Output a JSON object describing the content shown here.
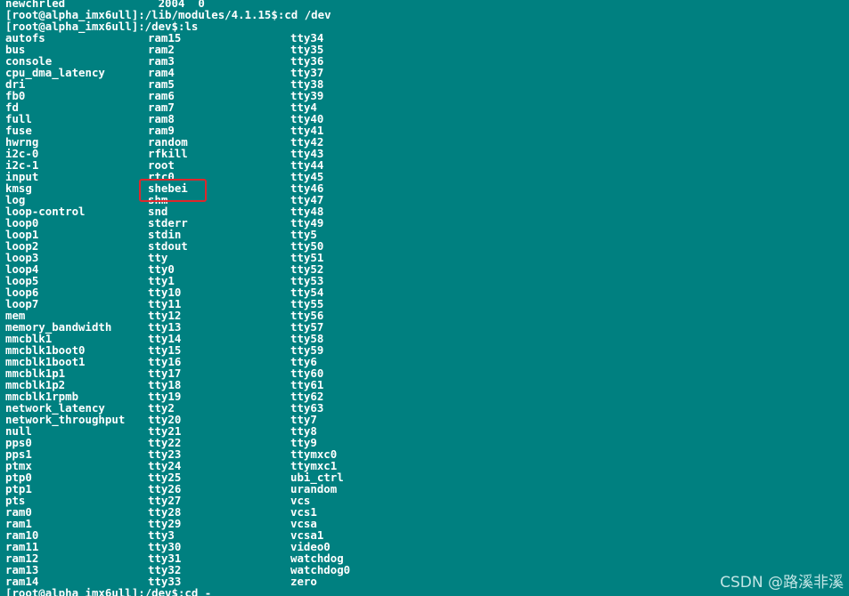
{
  "terminal": {
    "line_prev": "newchrled              2004  0",
    "line_cd_dev": "[root@alpha_imx6ull]:/lib/modules/4.1.15$:cd /dev",
    "line_ls": "[root@alpha_imx6ull]:/dev$:ls",
    "line_last": "[root@alpha_imx6ull]:/dev$:cd -",
    "highlight_color": "#e0262b",
    "background_color": "#008080",
    "text_color": "#ffffff"
  },
  "listing": {
    "col1": [
      "autofs",
      "bus",
      "console",
      "cpu_dma_latency",
      "dri",
      "fb0",
      "fd",
      "full",
      "fuse",
      "hwrng",
      "i2c-0",
      "i2c-1",
      "input",
      "kmsg",
      "log",
      "loop-control",
      "loop0",
      "loop1",
      "loop2",
      "loop3",
      "loop4",
      "loop5",
      "loop6",
      "loop7",
      "mem",
      "memory_bandwidth",
      "mmcblk1",
      "mmcblk1boot0",
      "mmcblk1boot1",
      "mmcblk1p1",
      "mmcblk1p2",
      "mmcblk1rpmb",
      "network_latency",
      "network_throughput",
      "null",
      "pps0",
      "pps1",
      "ptmx",
      "ptp0",
      "ptp1",
      "pts",
      "ram0",
      "ram1",
      "ram10",
      "ram11",
      "ram12",
      "ram13",
      "ram14"
    ],
    "col2": [
      "ram15",
      "ram2",
      "ram3",
      "ram4",
      "ram5",
      "ram6",
      "ram7",
      "ram8",
      "ram9",
      "random",
      "rfkill",
      "root",
      "rtc0",
      "shebei",
      "shm",
      "snd",
      "stderr",
      "stdin",
      "stdout",
      "tty",
      "tty0",
      "tty1",
      "tty10",
      "tty11",
      "tty12",
      "tty13",
      "tty14",
      "tty15",
      "tty16",
      "tty17",
      "tty18",
      "tty19",
      "tty2",
      "tty20",
      "tty21",
      "tty22",
      "tty23",
      "tty24",
      "tty25",
      "tty26",
      "tty27",
      "tty28",
      "tty29",
      "tty3",
      "tty30",
      "tty31",
      "tty32",
      "tty33"
    ],
    "col3": [
      "tty34",
      "tty35",
      "tty36",
      "tty37",
      "tty38",
      "tty39",
      "tty4",
      "tty40",
      "tty41",
      "tty42",
      "tty43",
      "tty44",
      "tty45",
      "tty46",
      "tty47",
      "tty48",
      "tty49",
      "tty5",
      "tty50",
      "tty51",
      "tty52",
      "tty53",
      "tty54",
      "tty55",
      "tty56",
      "tty57",
      "tty58",
      "tty59",
      "tty6",
      "tty60",
      "tty61",
      "tty62",
      "tty63",
      "tty7",
      "tty8",
      "tty9",
      "ttymxc0",
      "ttymxc1",
      "ubi_ctrl",
      "urandom",
      "vcs",
      "vcs1",
      "vcsa",
      "vcsa1",
      "video0",
      "watchdog",
      "watchdog0",
      "zero"
    ]
  },
  "watermark": {
    "text": "CSDN @路溪非溪"
  }
}
